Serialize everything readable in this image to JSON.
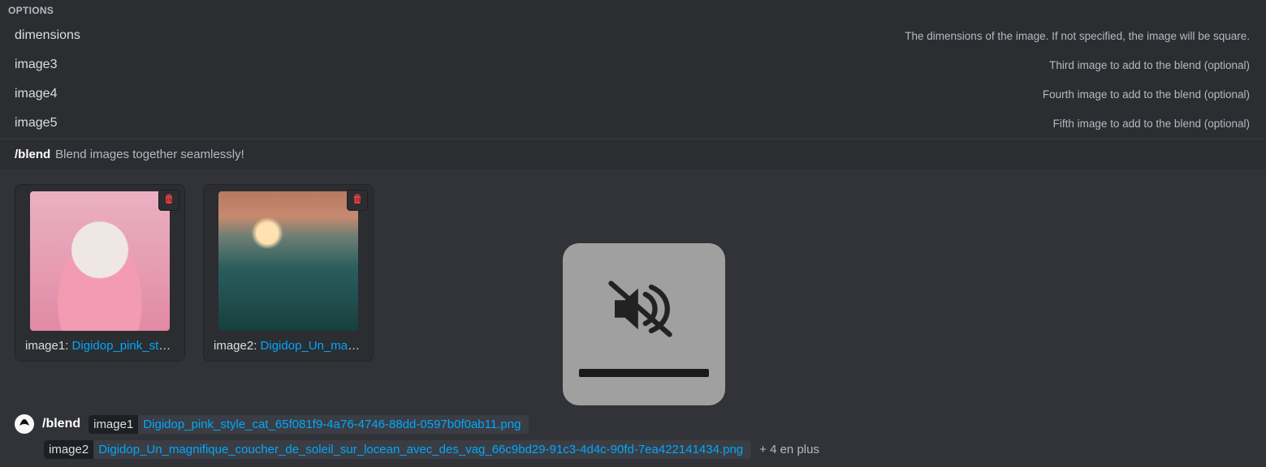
{
  "options_header": "OPTIONS",
  "options": [
    {
      "name": "dimensions",
      "desc": "The dimensions of the image. If not specified, the image will be square."
    },
    {
      "name": "image3",
      "desc": "Third image to add to the blend (optional)"
    },
    {
      "name": "image4",
      "desc": "Fourth image to add to the blend (optional)"
    },
    {
      "name": "image5",
      "desc": "Fifth image to add to the blend (optional)"
    }
  ],
  "command": {
    "name": "/blend",
    "desc": "Blend images together seamlessly!"
  },
  "attachments": [
    {
      "slot": "image1",
      "filename_short": "Digidop_pink_style…"
    },
    {
      "slot": "image2",
      "filename_short": "Digidop_Un_magni…"
    }
  ],
  "input": {
    "command": "/blend",
    "param1": "image1",
    "value1": "Digidop_pink_style_cat_65f081f9-4a76-4746-88dd-0597b0f0ab11.png",
    "param2": "image2",
    "value2": "Digidop_Un_magnifique_coucher_de_soleil_sur_locean_avec_des_vag_66c9bd29-91c3-4d4c-90fd-7ea422141434.png",
    "more": "+ 4 en plus"
  }
}
